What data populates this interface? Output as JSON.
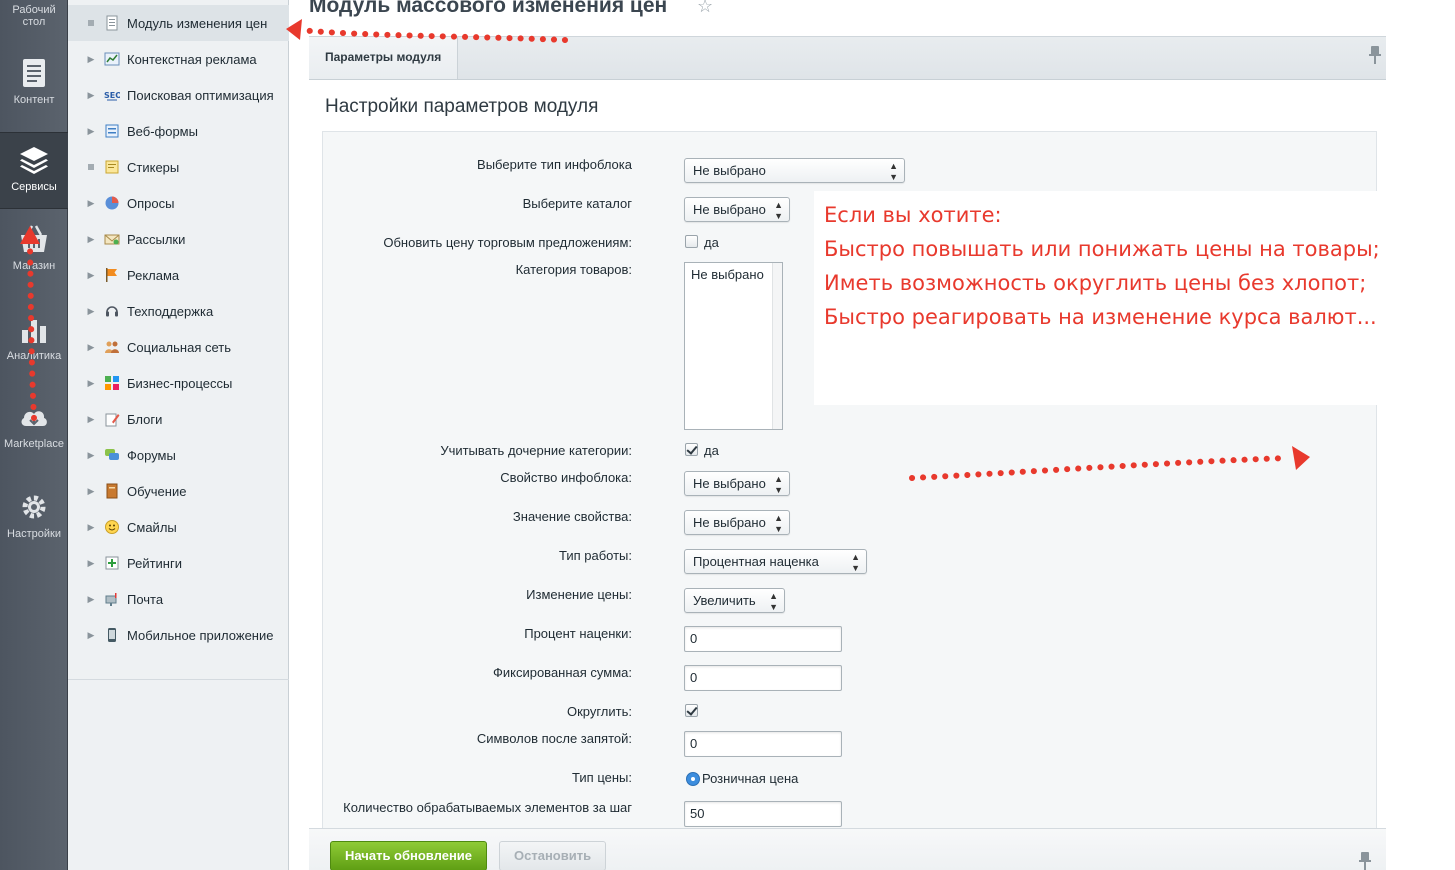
{
  "rail": {
    "items": [
      {
        "label": "Рабочий стол",
        "icon": "desktop-icon"
      },
      {
        "label": "Контент",
        "icon": "document-icon"
      },
      {
        "label": "Сервисы",
        "icon": "layers-icon"
      },
      {
        "label": "Магазин",
        "icon": "basket-icon"
      },
      {
        "label": "Аналитика",
        "icon": "bar-chart-icon"
      },
      {
        "label": "Marketplace",
        "icon": "cloud-download-icon"
      },
      {
        "label": "Настройки",
        "icon": "gear-icon"
      }
    ]
  },
  "menu": {
    "items": [
      {
        "label": "Модуль изменения цен"
      },
      {
        "label": "Контекстная реклама"
      },
      {
        "label": "Поисковая оптимизация"
      },
      {
        "label": "Веб-формы"
      },
      {
        "label": "Стикеры"
      },
      {
        "label": "Опросы"
      },
      {
        "label": "Рассылки"
      },
      {
        "label": "Реклама"
      },
      {
        "label": "Техподдержка"
      },
      {
        "label": "Социальная сеть"
      },
      {
        "label": "Бизнес-процессы"
      },
      {
        "label": "Блоги"
      },
      {
        "label": "Форумы"
      },
      {
        "label": "Обучение"
      },
      {
        "label": "Смайлы"
      },
      {
        "label": "Рейтинги"
      },
      {
        "label": "Почта"
      },
      {
        "label": "Мобильное приложение"
      }
    ]
  },
  "header": {
    "title": "Модуль массового изменения цен",
    "tab_label": "Параметры модуля"
  },
  "section": {
    "title": "Настройки параметров модуля"
  },
  "form": {
    "iblock_type": {
      "label": "Выберите тип инфоблока",
      "value": "Не выбрано"
    },
    "catalog": {
      "label": "Выберите каталог",
      "value": "Не выбрано"
    },
    "update_offers": {
      "label": "Обновить цену торговым предложениям:",
      "option": "да",
      "checked": false
    },
    "category": {
      "label": "Категория товаров:",
      "value": "Не выбрано"
    },
    "child_categories": {
      "label": "Учитывать дочерние категории:",
      "option": "да",
      "checked": true
    },
    "iblock_property": {
      "label": "Свойство инфоблока:",
      "value": "Не выбрано"
    },
    "property_value": {
      "label": "Значение свойства:",
      "value": "Не выбрано"
    },
    "work_type": {
      "label": "Тип работы:",
      "value": "Процентная наценка"
    },
    "price_change": {
      "label": "Изменение цены:",
      "value": "Увеличить"
    },
    "markup_percent": {
      "label": "Процент наценки:",
      "value": "0"
    },
    "fixed_sum": {
      "label": "Фиксированная сумма:",
      "value": "0"
    },
    "round": {
      "label": "Округлить:",
      "checked": true
    },
    "decimals": {
      "label": "Символов после запятой:",
      "value": "0"
    },
    "price_type": {
      "label": "Тип цены:",
      "value": "Розничная цена"
    },
    "per_step": {
      "label": "Количество обрабатываемых элементов за шаг",
      "value": "50"
    }
  },
  "promo": {
    "lines": [
      "Если вы хотите:",
      "Быстро повышать или понижать цены на товары;",
      "Иметь возможность округлить цены без хлопот;",
      "Быстро реагировать на изменение курса валют..."
    ],
    "color": "#e8392d"
  },
  "footer": {
    "start_label": "Начать обновление",
    "stop_label": "Остановить"
  },
  "colors": {
    "accent_green": "#6cb31f",
    "annotation_red": "#e8392d",
    "radio_blue": "#3c8dde"
  }
}
